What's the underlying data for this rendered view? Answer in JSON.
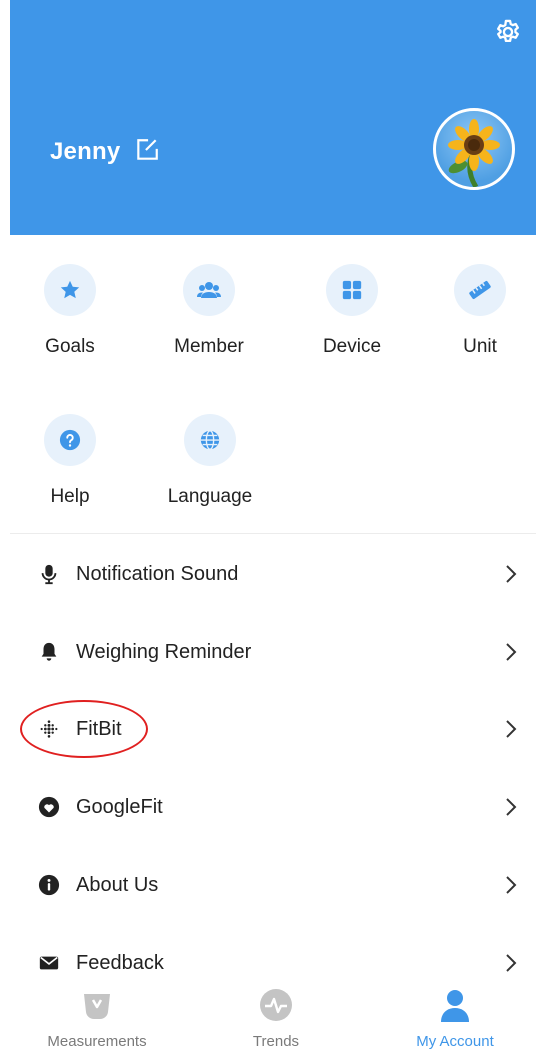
{
  "header": {
    "user_name": "Jenny",
    "bg_color": "#3f96e8",
    "icons": [
      "gear-icon",
      "edit-icon",
      "avatar-sunflower"
    ]
  },
  "grid": {
    "row1": [
      {
        "label": "Goals",
        "icon": "star-icon"
      },
      {
        "label": "Member",
        "icon": "users-icon"
      },
      {
        "label": "Device",
        "icon": "grid-icon"
      },
      {
        "label": "Unit",
        "icon": "ruler-icon"
      }
    ],
    "row2": [
      {
        "label": "Help",
        "icon": "help-icon"
      },
      {
        "label": "Language",
        "icon": "globe-icon"
      }
    ]
  },
  "list": [
    {
      "label": "Notification Sound",
      "icon": "microphone-icon"
    },
    {
      "label": "Weighing Reminder",
      "icon": "bell-icon"
    },
    {
      "label": "FitBit",
      "icon": "fitbit-icon"
    },
    {
      "label": "GoogleFit",
      "icon": "heart-icon"
    },
    {
      "label": "About Us",
      "icon": "info-icon"
    },
    {
      "label": "Feedback",
      "icon": "mail-icon"
    }
  ],
  "tabs": [
    {
      "label": "Measurements",
      "icon": "scale-icon",
      "active": false
    },
    {
      "label": "Trends",
      "icon": "pulse-icon",
      "active": false
    },
    {
      "label": "My Account",
      "icon": "person-icon",
      "active": true
    }
  ],
  "colors": {
    "accent": "#3f96e8",
    "highlight": "#e02020",
    "icon_bg": "#e7f1fb"
  }
}
